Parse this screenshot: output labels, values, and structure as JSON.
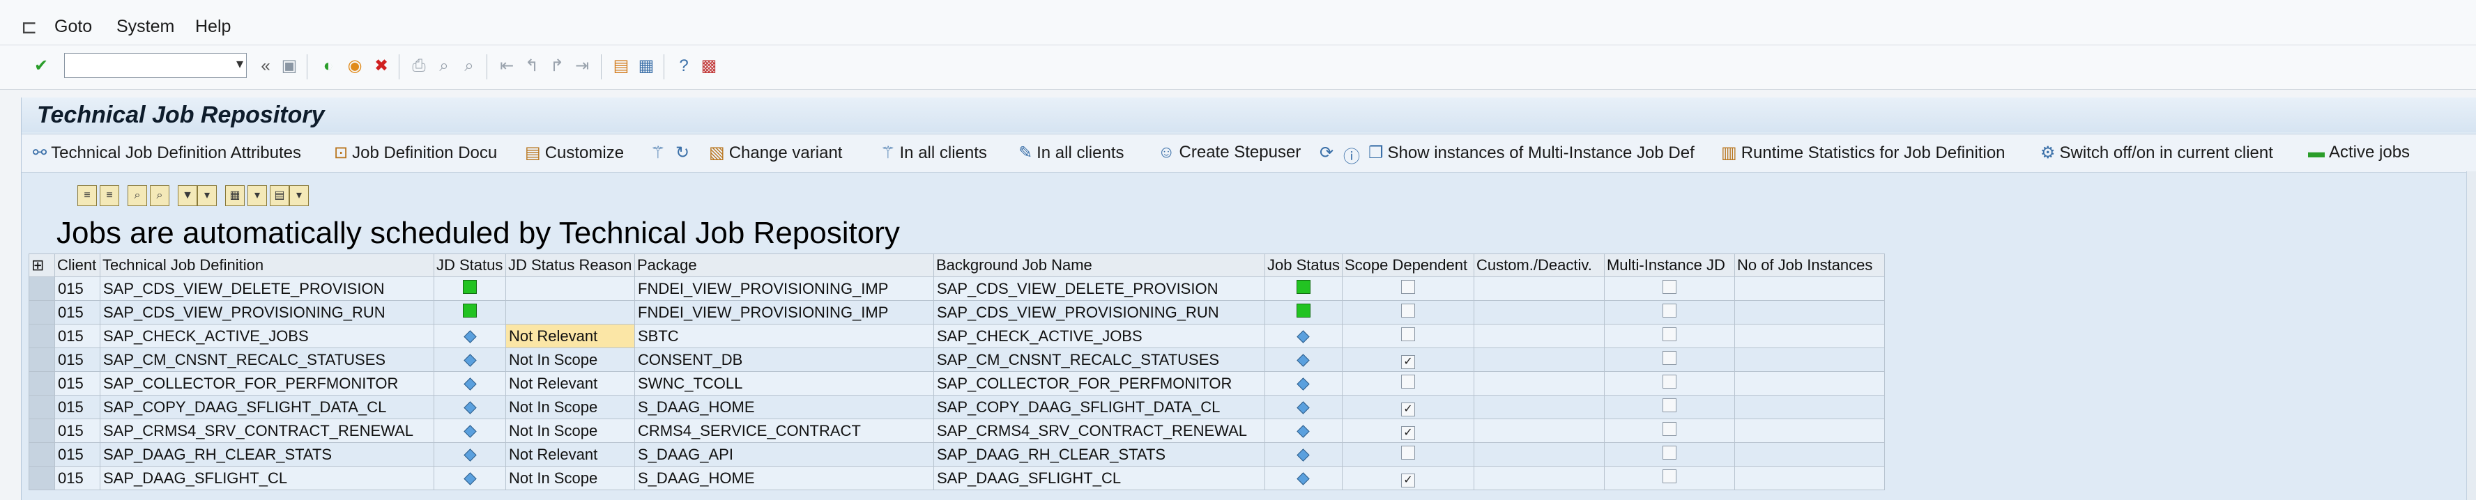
{
  "menu": {
    "items": [
      "Goto",
      "System",
      "Help"
    ]
  },
  "toolbar": {
    "command_placeholder": ""
  },
  "page_title": "Technical Job Repository",
  "app_toolbar": {
    "buttons": [
      "Technical Job Definition Attributes",
      "Job Definition Docu",
      "Customize",
      "Change variant",
      "In all clients",
      "In all clients",
      "Create Stepuser",
      "Show instances of Multi-Instance Job Def",
      "Runtime Statistics for Job Definition",
      "Switch off/on in current client",
      "Active jobs"
    ]
  },
  "list_header": "Jobs are automatically scheduled by Technical Job Repository",
  "table": {
    "columns": [
      "Client",
      "Technical Job Definition",
      "JD Status",
      "JD Status Reason",
      "Package",
      "Background Job Name",
      "Job Status",
      "Scope Dependent",
      "Custom./Deactiv.",
      "Multi-Instance JD",
      "No of Job Instances"
    ],
    "rows": [
      {
        "client": "015",
        "jd": "SAP_CDS_VIEW_DELETE_PROVISION",
        "jd_status": "green",
        "reason": "",
        "package": "FNDEI_VIEW_PROVISIONING_IMP",
        "job": "SAP_CDS_VIEW_DELETE_PROVISION",
        "job_status": "green",
        "scope": false,
        "custom": "",
        "multi": false,
        "instances": ""
      },
      {
        "client": "015",
        "jd": "SAP_CDS_VIEW_PROVISIONING_RUN",
        "jd_status": "green",
        "reason": "",
        "package": "FNDEI_VIEW_PROVISIONING_IMP",
        "job": "SAP_CDS_VIEW_PROVISIONING_RUN",
        "job_status": "green",
        "scope": false,
        "custom": "",
        "multi": false,
        "instances": ""
      },
      {
        "client": "015",
        "jd": "SAP_CHECK_ACTIVE_JOBS",
        "jd_status": "diamond",
        "reason": "Not Relevant",
        "package": "SBTC",
        "job": "SAP_CHECK_ACTIVE_JOBS",
        "job_status": "diamond",
        "scope": false,
        "custom": "",
        "multi": false,
        "instances": "",
        "highlight": true
      },
      {
        "client": "015",
        "jd": "SAP_CM_CNSNT_RECALC_STATUSES",
        "jd_status": "diamond",
        "reason": "Not In Scope",
        "package": "CONSENT_DB",
        "job": "SAP_CM_CNSNT_RECALC_STATUSES",
        "job_status": "diamond",
        "scope": true,
        "custom": "",
        "multi": false,
        "instances": ""
      },
      {
        "client": "015",
        "jd": "SAP_COLLECTOR_FOR_PERFMONITOR",
        "jd_status": "diamond",
        "reason": "Not Relevant",
        "package": "SWNC_TCOLL",
        "job": "SAP_COLLECTOR_FOR_PERFMONITOR",
        "job_status": "diamond",
        "scope": false,
        "custom": "",
        "multi": false,
        "instances": ""
      },
      {
        "client": "015",
        "jd": "SAP_COPY_DAAG_SFLIGHT_DATA_CL",
        "jd_status": "diamond",
        "reason": "Not In Scope",
        "package": "S_DAAG_HOME",
        "job": "SAP_COPY_DAAG_SFLIGHT_DATA_CL",
        "job_status": "diamond",
        "scope": true,
        "custom": "",
        "multi": false,
        "instances": ""
      },
      {
        "client": "015",
        "jd": "SAP_CRMS4_SRV_CONTRACT_RENEWAL",
        "jd_status": "diamond",
        "reason": "Not In Scope",
        "package": "CRMS4_SERVICE_CONTRACT",
        "job": "SAP_CRMS4_SRV_CONTRACT_RENEWAL",
        "job_status": "diamond",
        "scope": true,
        "custom": "",
        "multi": false,
        "instances": ""
      },
      {
        "client": "015",
        "jd": "SAP_DAAG_RH_CLEAR_STATS",
        "jd_status": "diamond",
        "reason": "Not Relevant",
        "package": "S_DAAG_API",
        "job": "SAP_DAAG_RH_CLEAR_STATS",
        "job_status": "diamond",
        "scope": false,
        "custom": "",
        "multi": false,
        "instances": ""
      },
      {
        "client": "015",
        "jd": "SAP_DAAG_SFLIGHT_CL",
        "jd_status": "diamond",
        "reason": "Not In Scope",
        "package": "S_DAAG_HOME",
        "job": "SAP_DAAG_SFLIGHT_CL",
        "job_status": "diamond",
        "scope": true,
        "custom": "",
        "multi": false,
        "instances": ""
      }
    ]
  }
}
